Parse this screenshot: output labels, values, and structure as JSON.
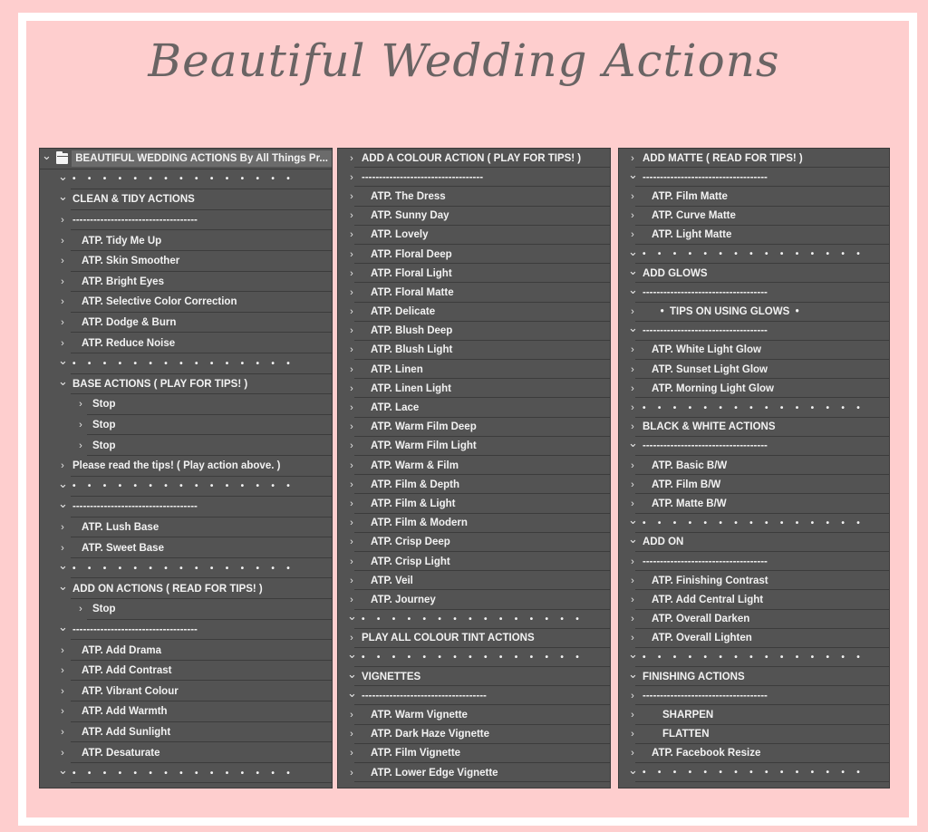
{
  "title": "Beautiful Wedding Actions",
  "colors": {
    "background": "#fecece",
    "frame": "#ffffff",
    "panel": "#535353",
    "text": "#f2f2f2",
    "title": "#6a6464"
  },
  "columns": [
    {
      "rows": [
        {
          "chevron": "down",
          "indent": 0,
          "label": "BEAUTIFUL WEDDING ACTIONS By All Things Pr...",
          "type": "set"
        },
        {
          "chevron": "down",
          "indent": 1,
          "label": "• • • • • • • • • • • • • • •",
          "type": "dots"
        },
        {
          "chevron": "down",
          "indent": 1,
          "label": "CLEAN & TIDY ACTIONS",
          "type": "heading"
        },
        {
          "chevron": "right",
          "indent": 1,
          "label": "------------------------------------",
          "type": "dashes"
        },
        {
          "chevron": "right",
          "indent": 1,
          "label": "ATP. Tidy Me Up",
          "type": "action"
        },
        {
          "chevron": "right",
          "indent": 1,
          "label": "ATP. Skin Smoother",
          "type": "action"
        },
        {
          "chevron": "right",
          "indent": 1,
          "label": "ATP. Bright Eyes",
          "type": "action"
        },
        {
          "chevron": "right",
          "indent": 1,
          "label": "ATP. Selective Color Correction",
          "type": "action"
        },
        {
          "chevron": "right",
          "indent": 1,
          "label": "ATP. Dodge & Burn",
          "type": "action"
        },
        {
          "chevron": "right",
          "indent": 1,
          "label": "ATP. Reduce Noise",
          "type": "action"
        },
        {
          "chevron": "down",
          "indent": 1,
          "label": "• • • • • • • • • • • • • • •",
          "type": "dots"
        },
        {
          "chevron": "down",
          "indent": 1,
          "label": "BASE ACTIONS ( PLAY FOR TIPS! )",
          "type": "heading"
        },
        {
          "chevron": "right",
          "indent": 2,
          "label": "Stop",
          "type": "step"
        },
        {
          "chevron": "right",
          "indent": 2,
          "label": "Stop",
          "type": "step"
        },
        {
          "chevron": "right",
          "indent": 2,
          "label": "Stop",
          "type": "step"
        },
        {
          "chevron": "right",
          "indent": 1,
          "label": "Please read the tips! ( Play action above. )",
          "type": "heading"
        },
        {
          "chevron": "down",
          "indent": 1,
          "label": "• • • • • • • • • • • • • • •",
          "type": "dots"
        },
        {
          "chevron": "down",
          "indent": 1,
          "label": "------------------------------------",
          "type": "dashes"
        },
        {
          "chevron": "right",
          "indent": 1,
          "label": "ATP. Lush Base",
          "type": "action"
        },
        {
          "chevron": "right",
          "indent": 1,
          "label": "ATP. Sweet Base",
          "type": "action"
        },
        {
          "chevron": "down",
          "indent": 1,
          "label": "• • • • • • • • • • • • • • •",
          "type": "dots"
        },
        {
          "chevron": "down",
          "indent": 1,
          "label": "ADD ON ACTIONS ( READ FOR TIPS! )",
          "type": "heading"
        },
        {
          "chevron": "right",
          "indent": 2,
          "label": "Stop",
          "type": "step"
        },
        {
          "chevron": "down",
          "indent": 1,
          "label": "------------------------------------",
          "type": "dashes"
        },
        {
          "chevron": "right",
          "indent": 1,
          "label": "ATP. Add Drama",
          "type": "action"
        },
        {
          "chevron": "right",
          "indent": 1,
          "label": "ATP. Add Contrast",
          "type": "action"
        },
        {
          "chevron": "right",
          "indent": 1,
          "label": "ATP. Vibrant Colour",
          "type": "action"
        },
        {
          "chevron": "right",
          "indent": 1,
          "label": "ATP. Add Warmth",
          "type": "action"
        },
        {
          "chevron": "right",
          "indent": 1,
          "label": "ATP. Add Sunlight",
          "type": "action"
        },
        {
          "chevron": "right",
          "indent": 1,
          "label": "ATP. Desaturate",
          "type": "action"
        },
        {
          "chevron": "down",
          "indent": 1,
          "label": "• • • • • • • • • • • • • • •",
          "type": "dots"
        }
      ]
    },
    {
      "rows": [
        {
          "chevron": "right",
          "indent": 1,
          "label": "ADD A COLOUR ACTION ( PLAY FOR TIPS! )",
          "type": "heading"
        },
        {
          "chevron": "right",
          "indent": 1,
          "label": "-----------------------------------",
          "type": "dashes"
        },
        {
          "chevron": "right",
          "indent": 1,
          "label": "ATP. The Dress",
          "type": "action"
        },
        {
          "chevron": "right",
          "indent": 1,
          "label": "ATP. Sunny Day",
          "type": "action"
        },
        {
          "chevron": "right",
          "indent": 1,
          "label": "ATP. Lovely",
          "type": "action"
        },
        {
          "chevron": "right",
          "indent": 1,
          "label": "ATP. Floral Deep",
          "type": "action"
        },
        {
          "chevron": "right",
          "indent": 1,
          "label": "ATP. Floral Light",
          "type": "action"
        },
        {
          "chevron": "right",
          "indent": 1,
          "label": "ATP. Floral Matte",
          "type": "action"
        },
        {
          "chevron": "right",
          "indent": 1,
          "label": "ATP. Delicate",
          "type": "action"
        },
        {
          "chevron": "right",
          "indent": 1,
          "label": "ATP. Blush Deep",
          "type": "action"
        },
        {
          "chevron": "right",
          "indent": 1,
          "label": "ATP. Blush Light",
          "type": "action"
        },
        {
          "chevron": "right",
          "indent": 1,
          "label": "ATP. Linen",
          "type": "action"
        },
        {
          "chevron": "right",
          "indent": 1,
          "label": "ATP. Linen Light",
          "type": "action"
        },
        {
          "chevron": "right",
          "indent": 1,
          "label": "ATP. Lace",
          "type": "action"
        },
        {
          "chevron": "right",
          "indent": 1,
          "label": "ATP. Warm Film Deep",
          "type": "action"
        },
        {
          "chevron": "right",
          "indent": 1,
          "label": "ATP. Warm Film Light",
          "type": "action"
        },
        {
          "chevron": "right",
          "indent": 1,
          "label": "ATP. Warm & Film",
          "type": "action"
        },
        {
          "chevron": "right",
          "indent": 1,
          "label": "ATP. Film & Depth",
          "type": "action"
        },
        {
          "chevron": "right",
          "indent": 1,
          "label": "ATP. Film & Light",
          "type": "action"
        },
        {
          "chevron": "right",
          "indent": 1,
          "label": "ATP. Film & Modern",
          "type": "action"
        },
        {
          "chevron": "right",
          "indent": 1,
          "label": "ATP. Crisp Deep",
          "type": "action"
        },
        {
          "chevron": "right",
          "indent": 1,
          "label": "ATP. Crisp Light",
          "type": "action"
        },
        {
          "chevron": "right",
          "indent": 1,
          "label": "ATP. Veil",
          "type": "action"
        },
        {
          "chevron": "right",
          "indent": 1,
          "label": "ATP. Journey",
          "type": "action"
        },
        {
          "chevron": "down",
          "indent": 1,
          "label": "• • • • • • • • • • • • • • •",
          "type": "dots"
        },
        {
          "chevron": "right",
          "indent": 1,
          "label": "PLAY ALL COLOUR TINT ACTIONS",
          "type": "heading"
        },
        {
          "chevron": "down",
          "indent": 1,
          "label": "• • • • • • • • • • • • • • •",
          "type": "dots"
        },
        {
          "chevron": "down",
          "indent": 1,
          "label": "VIGNETTES",
          "type": "heading"
        },
        {
          "chevron": "down",
          "indent": 1,
          "label": "------------------------------------",
          "type": "dashes"
        },
        {
          "chevron": "right",
          "indent": 1,
          "label": "ATP. Warm Vignette",
          "type": "action"
        },
        {
          "chevron": "right",
          "indent": 1,
          "label": "ATP. Dark Haze Vignette",
          "type": "action"
        },
        {
          "chevron": "right",
          "indent": 1,
          "label": "ATP. Film Vignette",
          "type": "action"
        },
        {
          "chevron": "right",
          "indent": 1,
          "label": "ATP. Lower Edge Vignette",
          "type": "action"
        }
      ]
    },
    {
      "rows": [
        {
          "chevron": "right",
          "indent": 1,
          "label": "ADD MATTE ( READ FOR TIPS! )",
          "type": "heading"
        },
        {
          "chevron": "down",
          "indent": 1,
          "label": "------------------------------------",
          "type": "dashes"
        },
        {
          "chevron": "right",
          "indent": 1,
          "label": "ATP. Film Matte",
          "type": "action"
        },
        {
          "chevron": "right",
          "indent": 1,
          "label": "ATP. Curve Matte",
          "type": "action"
        },
        {
          "chevron": "right",
          "indent": 1,
          "label": "ATP. Light Matte",
          "type": "action"
        },
        {
          "chevron": "down",
          "indent": 1,
          "label": "• • • • • • • • • • • • • • •",
          "type": "dots"
        },
        {
          "chevron": "down",
          "indent": 1,
          "label": "ADD GLOWS",
          "type": "heading"
        },
        {
          "chevron": "down",
          "indent": 1,
          "label": "------------------------------------",
          "type": "dashes"
        },
        {
          "chevron": "right",
          "indent": 1,
          "label": "   •  TIPS ON USING GLOWS  •",
          "type": "action"
        },
        {
          "chevron": "down",
          "indent": 1,
          "label": "------------------------------------",
          "type": "dashes"
        },
        {
          "chevron": "right",
          "indent": 1,
          "label": "ATP. White Light Glow",
          "type": "action"
        },
        {
          "chevron": "right",
          "indent": 1,
          "label": "ATP. Sunset Light Glow",
          "type": "action"
        },
        {
          "chevron": "right",
          "indent": 1,
          "label": "ATP. Morning Light Glow",
          "type": "action"
        },
        {
          "chevron": "right",
          "indent": 1,
          "label": "• • • • • • • • • • • • • • •",
          "type": "dots"
        },
        {
          "chevron": "right",
          "indent": 1,
          "label": "BLACK & WHITE ACTIONS",
          "type": "heading"
        },
        {
          "chevron": "down",
          "indent": 1,
          "label": "------------------------------------",
          "type": "dashes"
        },
        {
          "chevron": "right",
          "indent": 1,
          "label": "ATP. Basic B/W",
          "type": "action"
        },
        {
          "chevron": "right",
          "indent": 1,
          "label": "ATP. Film B/W",
          "type": "action"
        },
        {
          "chevron": "right",
          "indent": 1,
          "label": "ATP. Matte B/W",
          "type": "action"
        },
        {
          "chevron": "down",
          "indent": 1,
          "label": "• • • • • • • • • • • • • • •",
          "type": "dots"
        },
        {
          "chevron": "down",
          "indent": 1,
          "label": "ADD ON",
          "type": "heading"
        },
        {
          "chevron": "right",
          "indent": 1,
          "label": "------------------------------------",
          "type": "dashes"
        },
        {
          "chevron": "right",
          "indent": 1,
          "label": "ATP. Finishing Contrast",
          "type": "action"
        },
        {
          "chevron": "right",
          "indent": 1,
          "label": "ATP. Add Central Light",
          "type": "action"
        },
        {
          "chevron": "right",
          "indent": 1,
          "label": "ATP. Overall Darken",
          "type": "action"
        },
        {
          "chevron": "right",
          "indent": 1,
          "label": "ATP. Overall Lighten",
          "type": "action"
        },
        {
          "chevron": "down",
          "indent": 1,
          "label": "• • • • • • • • • • • • • • •",
          "type": "dots"
        },
        {
          "chevron": "down",
          "indent": 1,
          "label": "FINISHING ACTIONS",
          "type": "heading"
        },
        {
          "chevron": "right",
          "indent": 1,
          "label": "------------------------------------",
          "type": "dashes"
        },
        {
          "chevron": "right",
          "indent": 1,
          "label": "SHARPEN",
          "type": "action-deep"
        },
        {
          "chevron": "right",
          "indent": 1,
          "label": "FLATTEN",
          "type": "action-deep"
        },
        {
          "chevron": "right",
          "indent": 1,
          "label": "ATP. Facebook Resize",
          "type": "action"
        },
        {
          "chevron": "down",
          "indent": 1,
          "label": "• • • • • • • • • • • • • • •",
          "type": "dots"
        }
      ]
    }
  ]
}
